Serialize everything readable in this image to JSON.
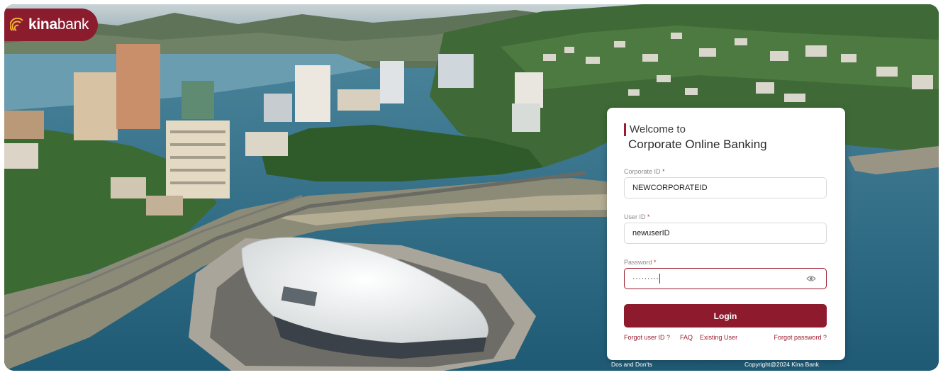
{
  "brand": {
    "name_bold": "kina",
    "name_light": "bank",
    "color": "#8a1c2e"
  },
  "login": {
    "welcome": "Welcome to",
    "title": "Corporate Online Banking",
    "corporate_id": {
      "label": "Corporate ID",
      "value": "NEWCORPORATEID"
    },
    "user_id": {
      "label": "User ID",
      "value": "newuserID"
    },
    "password": {
      "label": "Password",
      "value": "·········"
    },
    "required_mark": "*",
    "login_label": "Login",
    "links": {
      "forgot_user": "Forgot user ID ?",
      "faq": "FAQ",
      "existing_user": "Existing User",
      "forgot_password": "Forgot password ?"
    }
  },
  "footer": {
    "dos": "Dos and Don'ts",
    "copyright": "Copyright@2024 Kina Bank"
  },
  "colors": {
    "accent": "#8e1a2d",
    "sea": "#2f6b86"
  },
  "icons": {
    "eye": "eye-icon",
    "logo": "kina-logo-icon"
  }
}
